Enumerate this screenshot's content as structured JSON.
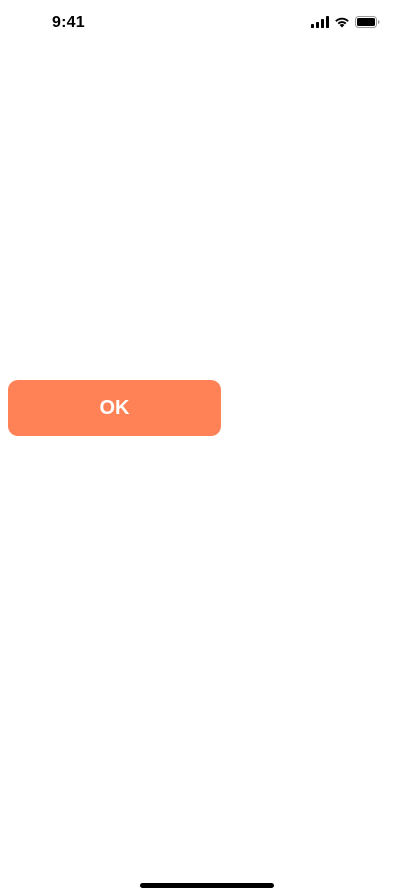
{
  "status_bar": {
    "time": "9:41",
    "icons": [
      "cellular-signal-icon",
      "wifi-icon",
      "battery-icon"
    ]
  },
  "main": {
    "ok_button_label": "OK"
  },
  "colors": {
    "accent": "#FF8156",
    "background": "#FFFFFF",
    "text_on_accent": "#FFFFFF"
  }
}
